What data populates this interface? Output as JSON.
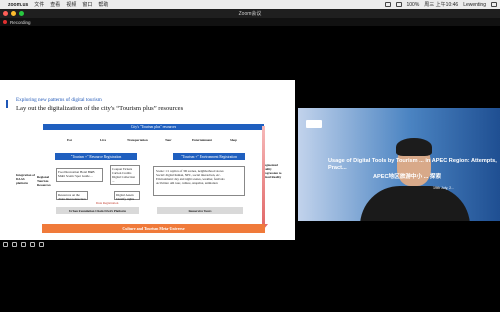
{
  "menubar": {
    "app_name": "zoom.us",
    "items": [
      "文件",
      "查看",
      "视频",
      "窗口",
      "帮助"
    ],
    "battery": "100%",
    "time": "周三 上午10:46",
    "user": "Lewenting"
  },
  "window": {
    "title": "Zoom会议"
  },
  "recording": {
    "label": "Recording"
  },
  "slide": {
    "subtitle": "Exploring new patterns of digital tourism",
    "title": "Lay out the digitalization of the city's “Tourism plus” resources",
    "top_bar": "City's \"Tourism plus\" resources",
    "categories": [
      "Eat",
      "Live",
      "Transportation",
      "Tour",
      "Entertainment",
      "Shop"
    ],
    "resource_reg": "\"Tourism +\" Resource Registration",
    "env_reg": "\"Tourism +\" Environment Registration",
    "left_label": "Integration of DAAS platform",
    "regional": "Regional Tourism Resources",
    "items_a": "Food Recreation Hotel B&B\nMulti Scenic Spot Guide ...",
    "items_b": "Coupon Tickets\nCarbon Credits\nDigital Collection ...",
    "resources_chain": "Resources on the chain Interconnection",
    "digital_assets": "Digital Assets Identify rights",
    "right_text": "Scene: 1:1 replica of 3D scenes, neighborhood stores\nSocial: digital human, NPC, social interaction, etc.\nEnvironment: day and night scenes, weather, festivals\nActivities: AR tour, culture, snapshot, animation",
    "augmented": "Augmented Reality Progression to Mixed Reality",
    "urban_platform": "Urban Foundation Chain DAAS Platform",
    "immersive": "Immersive Tours",
    "bottom_bar": "Culture and Tourism Meta-Universe",
    "hint": "Data Registration"
  },
  "camera": {
    "title": "Usage of Digital Tools by Tourism ... in APEC Region: Attempts, Pract...",
    "title_cn": "APEC地区旅游中小 ... 探索",
    "date": "19th July, 2..."
  }
}
